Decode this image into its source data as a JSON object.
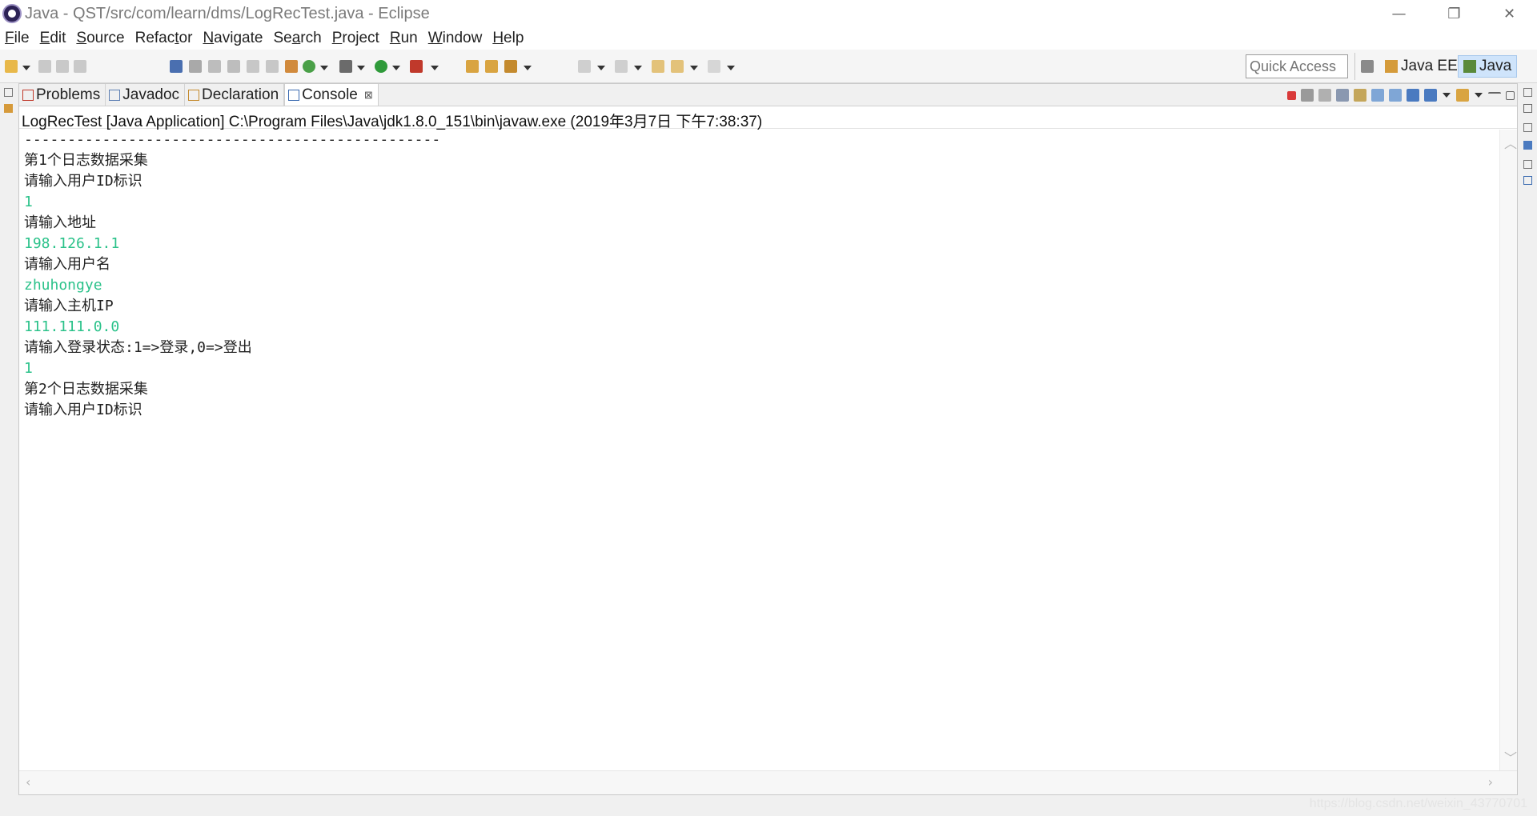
{
  "window": {
    "title": "Java - QST/src/com/learn/dms/LogRecTest.java - Eclipse",
    "minimize": "—",
    "restore": "❐",
    "close": "✕"
  },
  "menu": {
    "items": [
      {
        "u": "F",
        "rest": "ile"
      },
      {
        "u": "E",
        "rest": "dit"
      },
      {
        "u": "S",
        "rest": "ource"
      },
      {
        "pre": "Refac",
        "u": "t",
        "rest": "or"
      },
      {
        "u": "N",
        "rest": "avigate"
      },
      {
        "pre": "Se",
        "u": "a",
        "rest": "rch"
      },
      {
        "u": "P",
        "rest": "roject"
      },
      {
        "u": "R",
        "rest": "un"
      },
      {
        "u": "W",
        "rest": "indow"
      },
      {
        "u": "H",
        "rest": "elp"
      }
    ]
  },
  "toolbar": {
    "quick_access_placeholder": "Quick Access",
    "perspectives": [
      {
        "label": "Java EE",
        "icon": "java-ee-perspective-icon",
        "active": false
      },
      {
        "label": "Java",
        "icon": "java-perspective-icon",
        "active": true
      }
    ]
  },
  "view": {
    "tabs": [
      {
        "label": "Problems",
        "icon": "problems-icon",
        "active": false
      },
      {
        "label": "Javadoc",
        "icon": "javadoc-icon",
        "active": false
      },
      {
        "label": "Declaration",
        "icon": "declaration-icon",
        "active": false
      },
      {
        "label": "Console",
        "icon": "console-icon",
        "active": true,
        "close": "⊠"
      }
    ],
    "process_label": "LogRecTest [Java Application] C:\\Program Files\\Java\\jdk1.8.0_151\\bin\\javaw.exe (2019年3月7日 下午7:38:37)"
  },
  "console": {
    "lines": [
      {
        "text": "------------------------------------------------",
        "kind": "out"
      },
      {
        "text": "第1个日志数据采集",
        "kind": "out"
      },
      {
        "text": "请输入用户ID标识",
        "kind": "out"
      },
      {
        "text": "1",
        "kind": "in"
      },
      {
        "text": "请输入地址",
        "kind": "out"
      },
      {
        "text": "198.126.1.1",
        "kind": "in"
      },
      {
        "text": "请输入用户名",
        "kind": "out"
      },
      {
        "text": "zhuhongye",
        "kind": "in"
      },
      {
        "text": "请输入主机IP",
        "kind": "out"
      },
      {
        "text": "111.111.0.0",
        "kind": "in"
      },
      {
        "text": "请输入登录状态:1=>登录,0=>登出",
        "kind": "out"
      },
      {
        "text": "1",
        "kind": "in"
      },
      {
        "text": "第2个日志数据采集",
        "kind": "out"
      },
      {
        "text": "请输入用户ID标识",
        "kind": "out"
      }
    ]
  },
  "watermark": "https://blog.csdn.net/weixin_43770701",
  "colors": {
    "input_text": "#2bc28a",
    "output_text": "#222222",
    "active_perspective": "#cfe4fb"
  }
}
